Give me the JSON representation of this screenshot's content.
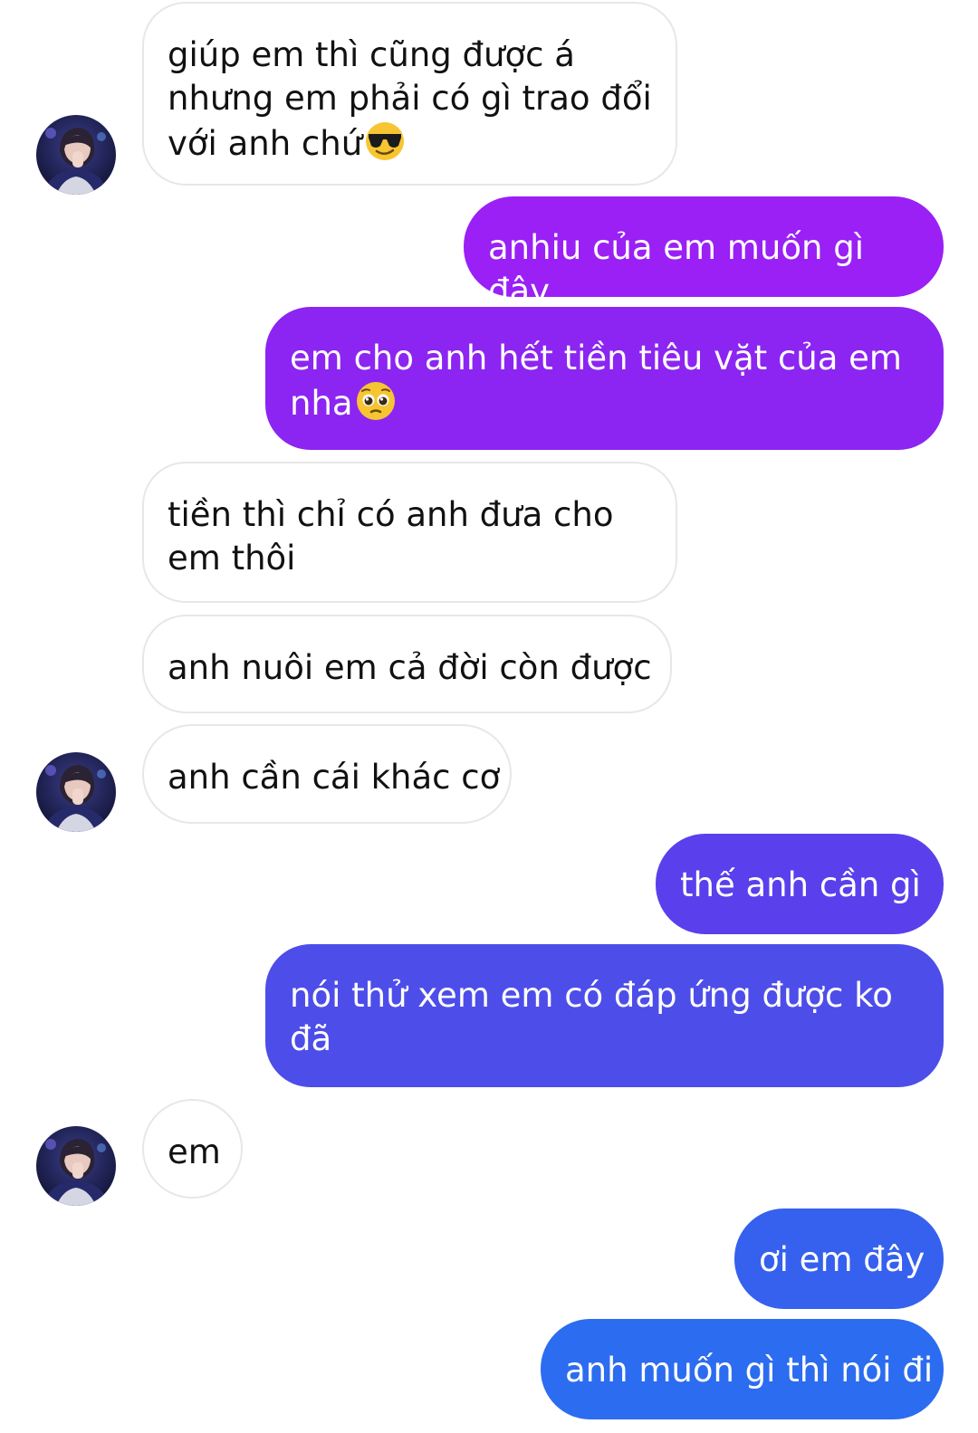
{
  "conversation": {
    "messages": [
      {
        "sender": "them",
        "text": "giúp em thì cũng được á nhưng em phải có gì trao đổi với anh chứ",
        "emoji": "sunglasses-face"
      },
      {
        "sender": "me",
        "text": "anhiu của em muốn gì đây"
      },
      {
        "sender": "me",
        "text": "em cho anh hết tiền tiêu vặt của em nha",
        "emoji": "pleading-face"
      },
      {
        "sender": "them",
        "text": "tiền thì chỉ có anh đưa cho em thôi"
      },
      {
        "sender": "them",
        "text": "anh nuôi em cả đời còn được"
      },
      {
        "sender": "them",
        "text": "anh cần cái khác cơ"
      },
      {
        "sender": "me",
        "text": "thế anh cần gì"
      },
      {
        "sender": "me",
        "text": "nói thử xem em có đáp ứng được ko đã"
      },
      {
        "sender": "them",
        "text": "em"
      },
      {
        "sender": "me",
        "text": "ơi em đây"
      },
      {
        "sender": "me",
        "text": "anh muốn gì thì nói đi"
      }
    ]
  },
  "colors": {
    "incoming_bg": "#ffffff",
    "incoming_border": "#e7e7e7",
    "outgoing_gradient_top": "#9b1ff5",
    "outgoing_gradient_bottom": "#2a6af0"
  }
}
